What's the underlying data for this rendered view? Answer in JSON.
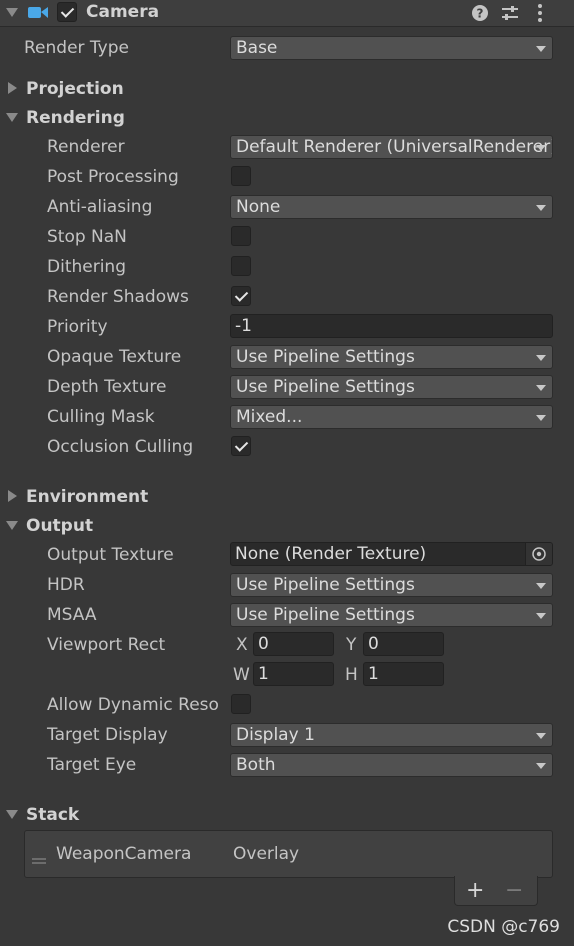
{
  "component": {
    "title": "Camera",
    "enabled": true
  },
  "general": {
    "render_type_label": "Render Type",
    "render_type_value": "Base"
  },
  "sections": {
    "projection": "Projection",
    "rendering": "Rendering",
    "environment": "Environment",
    "output": "Output",
    "stack": "Stack"
  },
  "rendering": {
    "renderer": {
      "label": "Renderer",
      "value": "Default Renderer (UniversalRenderer)"
    },
    "post_processing": {
      "label": "Post Processing",
      "checked": false
    },
    "anti_aliasing": {
      "label": "Anti-aliasing",
      "value": "None"
    },
    "stop_nan": {
      "label": "Stop NaN",
      "checked": false
    },
    "dithering": {
      "label": "Dithering",
      "checked": false
    },
    "render_shadows": {
      "label": "Render Shadows",
      "checked": true
    },
    "priority": {
      "label": "Priority",
      "value": "-1"
    },
    "opaque_texture": {
      "label": "Opaque Texture",
      "value": "Use Pipeline Settings"
    },
    "depth_texture": {
      "label": "Depth Texture",
      "value": "Use Pipeline Settings"
    },
    "culling_mask": {
      "label": "Culling Mask",
      "value": "Mixed..."
    },
    "occlusion_culling": {
      "label": "Occlusion Culling",
      "checked": true
    }
  },
  "output": {
    "output_texture": {
      "label": "Output Texture",
      "value": "None (Render Texture)"
    },
    "hdr": {
      "label": "HDR",
      "value": "Use Pipeline Settings"
    },
    "msaa": {
      "label": "MSAA",
      "value": "Use Pipeline Settings"
    },
    "viewport_rect": {
      "label": "Viewport Rect",
      "x_label": "X",
      "x": "0",
      "y_label": "Y",
      "y": "0",
      "w_label": "W",
      "w": "1",
      "h_label": "H",
      "h": "1"
    },
    "allow_dynamic_resolution": {
      "label": "Allow Dynamic Reso",
      "checked": false
    },
    "target_display": {
      "label": "Target Display",
      "value": "Display 1"
    },
    "target_eye": {
      "label": "Target Eye",
      "value": "Both"
    }
  },
  "stack": {
    "items": [
      {
        "name": "WeaponCamera",
        "type": "Overlay"
      }
    ],
    "add_label": "+",
    "remove_label": "−"
  },
  "icons": {
    "camera": "camera-icon",
    "help": "help-icon",
    "presets": "presets-icon",
    "menu": "more-vertical-icon"
  },
  "watermark": "CSDN @c769",
  "colors": {
    "background": "#383838",
    "camera_icon": "#4aa8e8",
    "field": "#515151",
    "input": "#2a2a2a"
  }
}
